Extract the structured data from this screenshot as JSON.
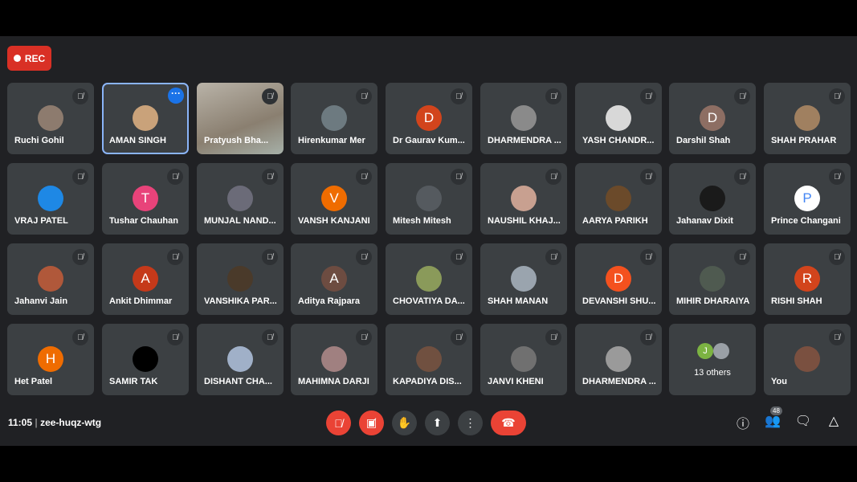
{
  "recording": {
    "label": "REC",
    "color": "#d93025"
  },
  "meeting": {
    "time": "11:05",
    "separator": "|",
    "code": "zee-huqz-wtg",
    "participant_count": "48"
  },
  "participants": [
    {
      "name": "Ruchi Gohil",
      "avatar": "photo",
      "color": "#8d7b6e",
      "muted": true
    },
    {
      "name": "AMAN SINGH",
      "avatar": "photo",
      "color": "#c9a27a",
      "muted": false,
      "active": true
    },
    {
      "name": "Pratyush Bha...",
      "avatar": "video",
      "muted": true
    },
    {
      "name": "Hirenkumar Mer",
      "avatar": "photo",
      "color": "#6d7a80",
      "muted": true
    },
    {
      "name": "Dr Gaurav Kum...",
      "avatar": "D",
      "color": "#d2441c",
      "muted": true
    },
    {
      "name": "DHARMENDRA ...",
      "avatar": "photo",
      "color": "#8a8a8a",
      "muted": true
    },
    {
      "name": "YASH CHANDR...",
      "avatar": "photo",
      "color": "#d8d8d8",
      "muted": true
    },
    {
      "name": "Darshil Shah",
      "avatar": "D",
      "color": "#8d6e63",
      "muted": true
    },
    {
      "name": "SHAH PRAHAR",
      "avatar": "photo",
      "color": "#a08060",
      "muted": true
    },
    {
      "name": "VRAJ PATEL",
      "avatar": "photo",
      "color": "#1e88e5",
      "muted": true
    },
    {
      "name": "Tushar Chauhan",
      "avatar": "T",
      "color": "#e8437a",
      "muted": true
    },
    {
      "name": "MUNJAL NAND...",
      "avatar": "photo",
      "color": "#6b6b78",
      "muted": true
    },
    {
      "name": "VANSH KANJANI",
      "avatar": "V",
      "color": "#ef6c00",
      "muted": true
    },
    {
      "name": "Mitesh Mitesh",
      "avatar": "photo",
      "color": "#555a5f",
      "muted": true
    },
    {
      "name": "NAUSHIL KHAJ...",
      "avatar": "photo",
      "color": "#c8a090",
      "muted": true
    },
    {
      "name": "AARYA PARIKH",
      "avatar": "photo",
      "color": "#6b4a2a",
      "muted": true
    },
    {
      "name": "Jahanav Dixit",
      "avatar": "photo",
      "color": "#1a1a1a",
      "muted": true
    },
    {
      "name": "Prince Changani",
      "avatar": "P",
      "color": "#ffffff",
      "muted": true
    },
    {
      "name": "Jahanvi Jain",
      "avatar": "photo",
      "color": "#b0583a",
      "muted": true
    },
    {
      "name": "Ankit Dhimmar",
      "avatar": "A",
      "color": "#c5391a",
      "muted": true
    },
    {
      "name": "VANSHIKA PAR...",
      "avatar": "photo",
      "color": "#4a3a2a",
      "muted": true
    },
    {
      "name": "Aditya Rajpara",
      "avatar": "A",
      "color": "#6d4c41",
      "muted": true
    },
    {
      "name": "CHOVATIYA DA...",
      "avatar": "photo",
      "color": "#8a9a5a",
      "muted": true
    },
    {
      "name": "SHAH MANAN",
      "avatar": "photo",
      "color": "#9aa4ae",
      "muted": true
    },
    {
      "name": "DEVANSHI SHU...",
      "avatar": "D",
      "color": "#f4511e",
      "muted": true
    },
    {
      "name": "MIHIR DHARAIYA",
      "avatar": "photo",
      "color": "#4f5a50",
      "muted": true
    },
    {
      "name": "RISHI SHAH",
      "avatar": "R",
      "color": "#d2441c",
      "muted": true
    },
    {
      "name": "Het Patel",
      "avatar": "H",
      "color": "#ef6c00",
      "muted": true
    },
    {
      "name": "SAMIR TAK",
      "avatar": "photo",
      "color": "#000000",
      "muted": true
    },
    {
      "name": "DISHANT CHA...",
      "avatar": "photo",
      "color": "#a0b0c8",
      "muted": true
    },
    {
      "name": "MAHIMNA DARJI",
      "avatar": "photo",
      "color": "#a08080",
      "muted": true
    },
    {
      "name": "KAPADIYA DIS...",
      "avatar": "photo",
      "color": "#705040",
      "muted": true
    },
    {
      "name": "JANVI KHENI",
      "avatar": "photo",
      "color": "#707070",
      "muted": true
    },
    {
      "name": "DHARMENDRA ...",
      "avatar": "photo",
      "color": "#9a9a9a",
      "muted": true
    },
    {
      "name": "13 others",
      "avatar": "others",
      "muted": false
    },
    {
      "name": "You",
      "avatar": "photo",
      "color": "#7a5040",
      "muted": true
    }
  ],
  "others_avatar_letter": "J",
  "controls": [
    "mic-off",
    "camera-off",
    "raise-hand",
    "present",
    "more-options",
    "leave-call"
  ],
  "right_icons": [
    "info",
    "people",
    "chat",
    "activities"
  ]
}
